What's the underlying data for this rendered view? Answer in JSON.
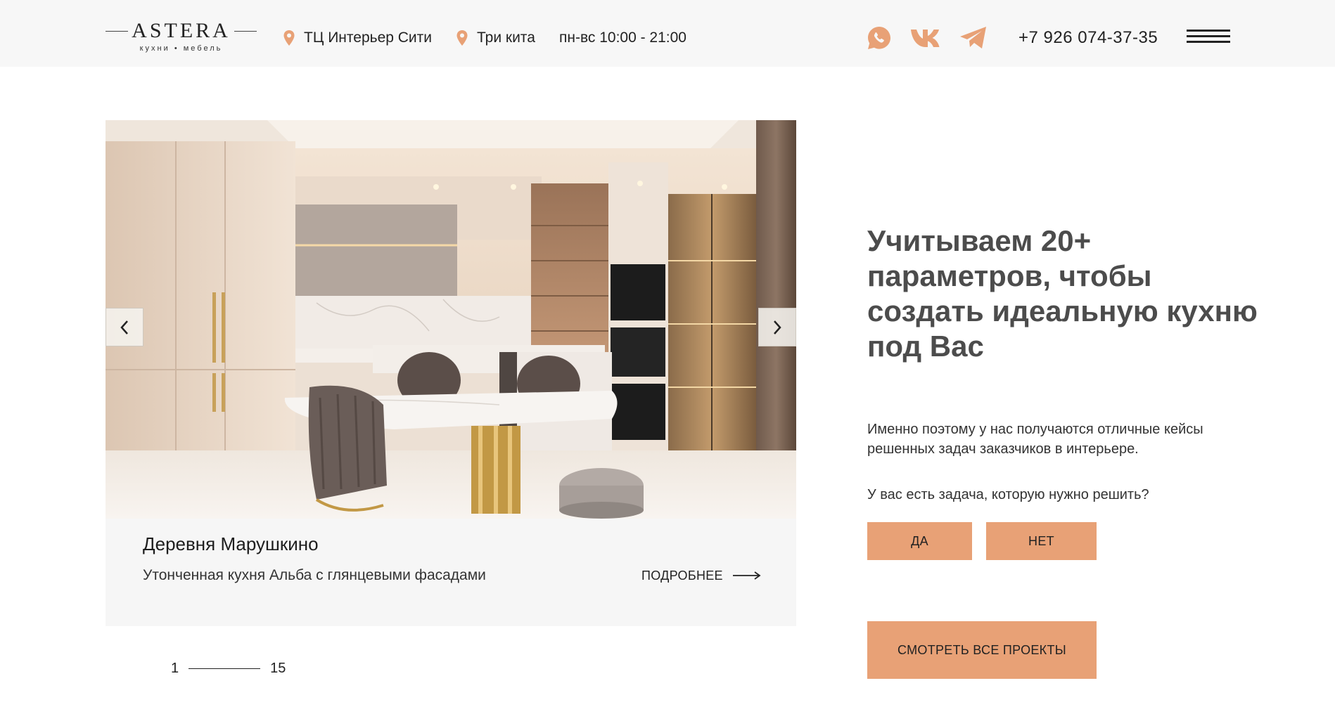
{
  "header": {
    "logo_word": "ASTERA",
    "logo_tagline": "кухни • мебель",
    "locations": [
      "ТЦ Интерьер Сити",
      "Три кита"
    ],
    "hours": "пн-вс 10:00 - 21:00",
    "phone": "+7 926 074-37-35",
    "accent": "#e8a176"
  },
  "slide": {
    "title": "Деревня Марушкино",
    "description": "Утонченная кухня Альба с глянцевыми фасадами",
    "more_label": "ПОДРОБНЕЕ"
  },
  "pager": {
    "current": "1",
    "total": "15"
  },
  "promo": {
    "headline": "Учитываем 20+ параметров, чтобы создать идеальную кухню под Вас",
    "paragraph": "Именно поэтому у нас получаются отличные кейсы решенных задач заказчиков в интерьере.",
    "question": "У вас есть задача, которую нужно решить?",
    "yes_label": "ДА",
    "no_label": "НЕТ",
    "all_projects_label": "СМОТРЕТЬ ВСЕ ПРОЕКТЫ"
  }
}
